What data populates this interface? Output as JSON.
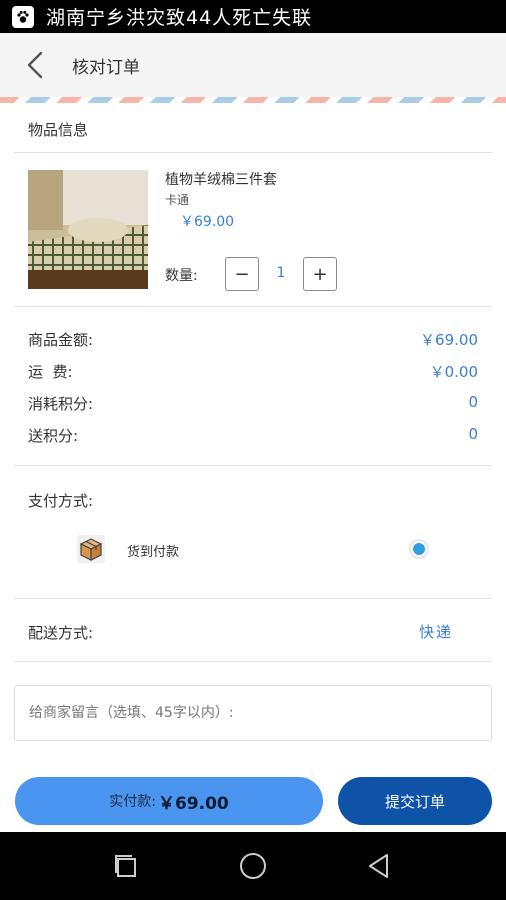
{
  "status_bar": {
    "notification_text": "湖南宁乡洪灾致44人死亡失联",
    "icon": "paw-icon"
  },
  "header": {
    "title": "核对订单",
    "back_icon": "back-arrow-icon"
  },
  "product_section": {
    "title": "物品信息",
    "item": {
      "name": "植物羊绒棉三件套",
      "spec": "卡通",
      "price": "￥69.00",
      "quantity_label": "数量:",
      "quantity": "1",
      "decrement_label": "−",
      "increment_label": "+"
    }
  },
  "amounts": [
    {
      "label": "商品金额:",
      "value": "￥69.00"
    },
    {
      "label": "运  费:",
      "value": "￥0.00"
    },
    {
      "label": "消耗积分:",
      "value": "0"
    },
    {
      "label": "送积分:",
      "value": "0"
    }
  ],
  "payment": {
    "title": "支付方式:",
    "option_label": "货到付款",
    "option_icon": "package-box-icon",
    "selected": true
  },
  "delivery": {
    "title": "配送方式:",
    "value": "快递"
  },
  "memo": {
    "placeholder": "给商家留言（选填、45字以内）:"
  },
  "footer": {
    "total_label": "实付款:",
    "total_value": "￥69.00",
    "submit_label": "提交订单"
  },
  "nav_bar": {
    "icons": [
      "recent-apps-icon",
      "home-icon",
      "back-icon"
    ]
  },
  "colors": {
    "accent": "#3b7fd4",
    "pay_button": "#4a95f0",
    "submit_button": "#0f53a8",
    "radio": "#2f9fdd"
  }
}
